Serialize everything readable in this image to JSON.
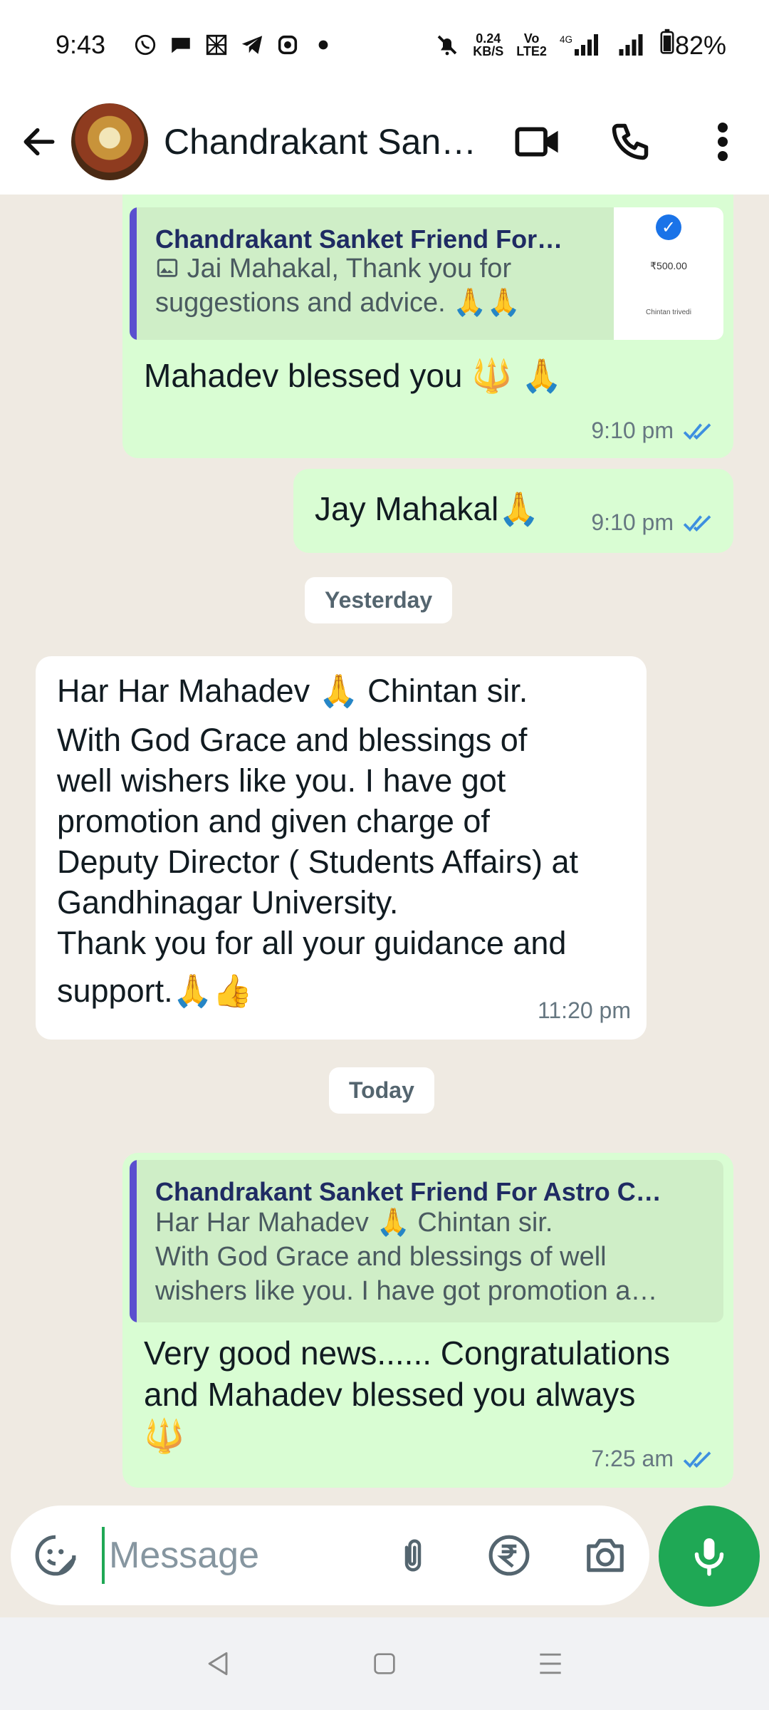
{
  "status_bar": {
    "time": "9:43",
    "data_speed_value": "0.24",
    "data_speed_unit": "KB/S",
    "volte_top": "Vo",
    "volte_bottom": "LTE2",
    "network": "4G",
    "battery": "82%"
  },
  "header": {
    "contact_name": "Chandrakant Sank…"
  },
  "messages": [
    {
      "direction": "outgoing",
      "quote_name": "Chandrakant Sanket Friend For…",
      "quote_text_line1": "Jai Mahakal, Thank you for",
      "quote_text_line2": "suggestions and advice. 🙏🙏",
      "thumb_amount": "₹500.00",
      "thumb_name": "Chintan trivedi",
      "text": "Mahadev blessed you 🔱 🙏",
      "time": "9:10 pm"
    },
    {
      "direction": "outgoing",
      "text": "Jay Mahakal🙏",
      "time": "9:10 pm"
    },
    {
      "direction": "incoming",
      "line1": "Har Har Mahadev 🙏 Chintan sir.",
      "line2": "With God Grace and blessings of",
      "line3": "well wishers like you. I have got",
      "line4": "promotion and given charge of",
      "line5": "Deputy Director ( Students Affairs) at",
      "line6": "Gandhinagar University.",
      "line7": "Thank you for all your guidance and",
      "line8": "support.🙏👍",
      "time": "11:20 pm"
    },
    {
      "direction": "outgoing",
      "quote_name": "Chandrakant Sanket Friend For Astro C…",
      "quote_line1": "Har Har Mahadev 🙏 Chintan sir.",
      "quote_line2": "With God Grace and blessings of well",
      "quote_line3": "wishers like you. I have got promotion a…",
      "line1": "Very good news...... Congratulations",
      "line2": "and Mahadev blessed you always",
      "line3": "🔱",
      "time": "7:25 am"
    }
  ],
  "date_chips": {
    "yesterday": "Yesterday",
    "today": "Today"
  },
  "input": {
    "placeholder": "Message"
  },
  "colors": {
    "outgoing_bubble": "#d9fdd3",
    "incoming_bubble": "#ffffff",
    "chat_background": "#efeae2",
    "accent_green": "#1fa855",
    "read_tick_blue": "#53bdeb",
    "quote_bar": "#5a4fcf"
  }
}
